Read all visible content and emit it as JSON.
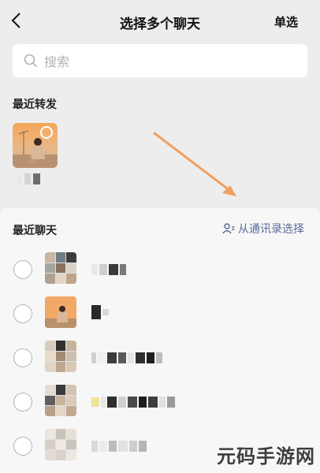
{
  "header": {
    "title": "选择多个聊天",
    "single_select": "单选"
  },
  "search": {
    "placeholder": "搜索"
  },
  "recent_forward": {
    "heading": "最近转发"
  },
  "recent_chats": {
    "heading": "最近聊天",
    "contacts_link": "从通讯录选择"
  },
  "accent_color": "#576b95",
  "annotation_arrow_color": "#f0a060",
  "watermark": "元码手游网"
}
